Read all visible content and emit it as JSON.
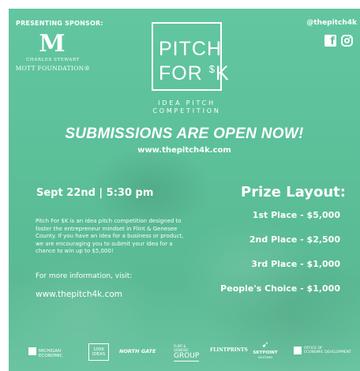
{
  "sponsor": {
    "label": "PRESENTING SPONSOR:",
    "logo_letter": "M",
    "name_line": "CHARLES STEWART",
    "foundation_line": "MOTT FOUNDATION®"
  },
  "social": {
    "handle": "@thepitch4k",
    "icons": [
      "facebook-icon",
      "instagram-icon"
    ]
  },
  "logo": {
    "line1": "PITCH",
    "line2_word": "FOR ",
    "line2_currency": "$",
    "line2_amount": "K",
    "subtitle_line1": "IDEA PITCH",
    "subtitle_line2": "COMPETITION"
  },
  "headline": "SUBMISSIONS ARE OPEN NOW!",
  "website_top": "www.thepitch4k.com",
  "event_date": "Sept 22nd | 5:30 pm",
  "description_lines": [
    "Pitch For $K is an idea pitch competition designed to",
    "foster the entrepreneur mindset in Flint & Genesee",
    "County. If you have an idea for a business or product,",
    "we are encouraging you to submit your idea for a",
    "chance to win up to $5,000!"
  ],
  "more_info": "For more information, visit:",
  "website_bottom": "www.thepitch4k.com",
  "prizes": {
    "title": "Prize Layout:",
    "items": [
      "1st Place - $5,000",
      "2nd Place - $2,500",
      "3rd Place - $1,000",
      "People's Choice - $1,000"
    ]
  },
  "footer_logos": {
    "michigan": "MICHIGAN ECONOMIC",
    "ideas_1": "100K",
    "ideas_2": "IDEAS",
    "northgate": "NORTH GATE",
    "group_small": "FLINT & GENESEE",
    "group": "GROUP",
    "flintprints": "FLINTPRINTS",
    "skypoint": "SKYPOINT",
    "skypoint_sub": "VENTURES",
    "office_1": "OFFICE OF",
    "office_2": "ECONOMIC DEVELOPMENT"
  },
  "colors": {
    "background": "#5dbf98",
    "text": "#ffffff"
  }
}
